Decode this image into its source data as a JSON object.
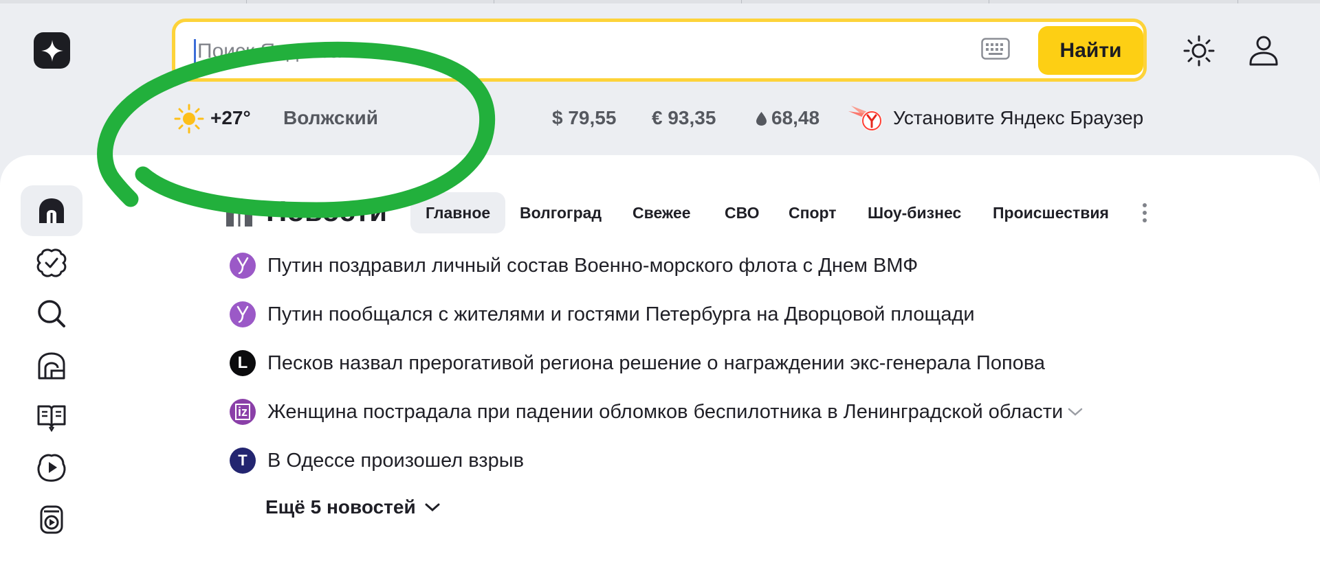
{
  "search": {
    "placeholder": "Поиск Яндекса",
    "button_label": "Найти"
  },
  "weather": {
    "temperature": "+27°",
    "city": "Волжский"
  },
  "rates": {
    "usd": "$ 79,55",
    "eur": "€ 93,35",
    "oil": "68,48"
  },
  "promo": {
    "text": "Установите Яндекс Браузер"
  },
  "sidebar": {
    "items": [
      {
        "icon": "home-icon"
      },
      {
        "icon": "services-check-icon"
      },
      {
        "icon": "search-icon"
      },
      {
        "icon": "market-icon"
      },
      {
        "icon": "book-icon"
      },
      {
        "icon": "video-play-icon"
      },
      {
        "icon": "music-icon"
      }
    ]
  },
  "news": {
    "title": "Новости",
    "tabs": [
      {
        "label": "Главное",
        "active": true
      },
      {
        "label": "Волгоград",
        "active": false
      },
      {
        "label": "Свежее",
        "active": false
      },
      {
        "label": "СВО",
        "active": false
      },
      {
        "label": "Спорт",
        "active": false
      },
      {
        "label": "Шоу-бизнес",
        "active": false
      },
      {
        "label": "Происшествия",
        "active": false
      }
    ],
    "items": [
      {
        "text": "Путин поздравил личный состав Военно-морского флота с Днем ВМФ",
        "source_icon": "source-purple-icon",
        "source_letter": "ү"
      },
      {
        "text": "Путин пообщался с жителями и гостями Петербурга на Дворцовой площади",
        "source_icon": "source-purple-icon",
        "source_letter": "ү"
      },
      {
        "text": "Песков назвал прерогативой региона решение о награждении экс-генерала Попова",
        "source_icon": "source-l-icon",
        "source_letter": "L"
      },
      {
        "text": "Женщина пострадала при падении обломков беспилотника в Ленинградской области",
        "source_icon": "source-iz-icon",
        "source_letter": "iz"
      },
      {
        "text": "В Одессе произошел взрыв",
        "source_icon": "source-t-icon",
        "source_letter": "T"
      }
    ],
    "more_label": "Ещё 5 новостей"
  },
  "colors": {
    "accent_yellow": "#fdcf14",
    "marker_green": "#22b03c",
    "page_bg": "#eceef2"
  }
}
